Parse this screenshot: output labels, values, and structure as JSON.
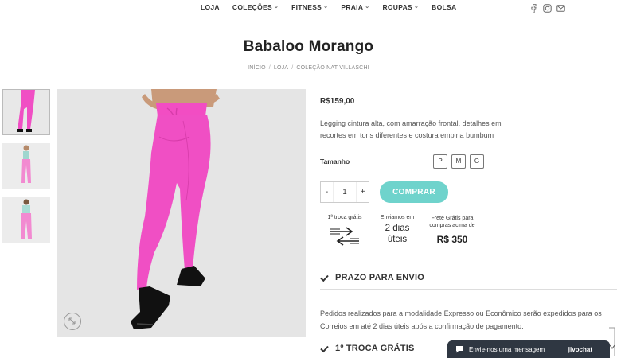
{
  "nav": {
    "items": [
      {
        "label": "LOJA",
        "has_dropdown": false
      },
      {
        "label": "COLEÇÕES",
        "has_dropdown": true
      },
      {
        "label": "FITNESS",
        "has_dropdown": true
      },
      {
        "label": "PRAIA",
        "has_dropdown": true
      },
      {
        "label": "ROUPAS",
        "has_dropdown": true
      },
      {
        "label": "BOLSA",
        "has_dropdown": false
      }
    ],
    "social_icons": [
      "facebook-icon",
      "instagram-icon",
      "email-icon"
    ]
  },
  "product": {
    "title": "Babaloo Morango",
    "breadcrumb": [
      "INÍCIO",
      "LOJA",
      "COLEÇÃO NAT VILLASCHI"
    ],
    "price": "R$159,00",
    "description": "Legging cintura alta, com amarração frontal, detalhes em recortes em tons diferentes e costura empina bumbum",
    "size_label": "Tamanho",
    "sizes": [
      "P",
      "M",
      "G"
    ],
    "quantity": "1",
    "qty_minus": "-",
    "qty_plus": "+",
    "buy_label": "COMPRAR"
  },
  "features": {
    "exchange_title": "1ª troca grátis",
    "shipping_title": "Enviamos em",
    "shipping_value_1": "2 dias",
    "shipping_value_2": "úteis",
    "free_shipping_title": "Frete Grátis para compras acima de",
    "free_shipping_value": "R$ 350"
  },
  "accordion": {
    "shipping_time_title": "PRAZO PARA ENVIO",
    "shipping_time_text": "Pedidos realizados para a modalidade Expresso ou Econômico serão expedidos para os Correios em até 2 dias úteis após a confirmação de pagamento.",
    "first_exchange_title": "1º TROCA GRÁTIS"
  },
  "chat": {
    "label": "Envie-nos uma mensagem",
    "brand": "jivochat"
  },
  "colors": {
    "accent": "#6fd3cc",
    "legging": "#f04fc4",
    "chat_bg": "#2f3742"
  }
}
